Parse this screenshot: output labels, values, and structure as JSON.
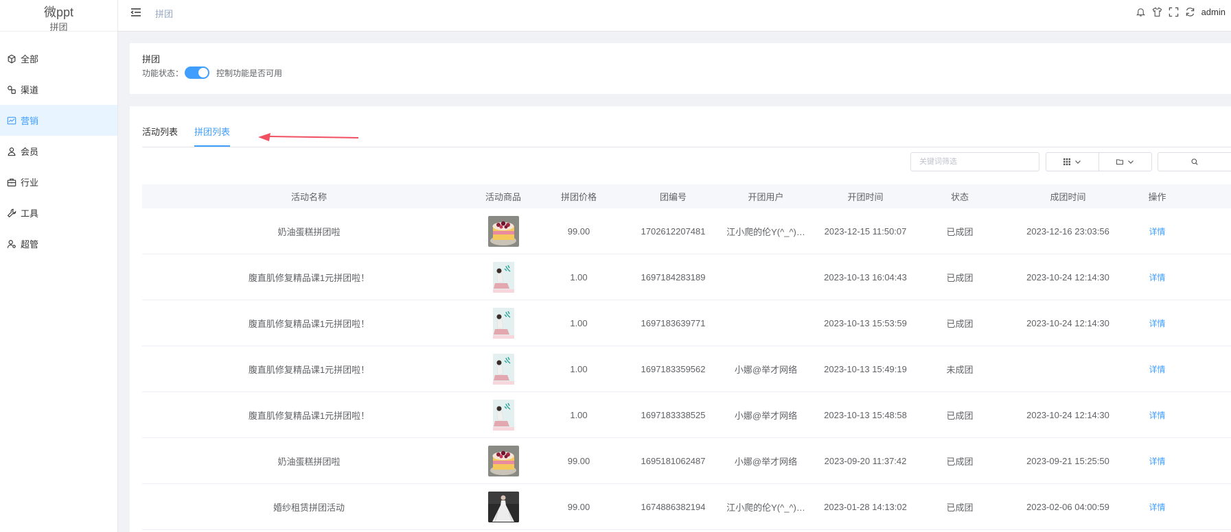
{
  "app": {
    "name": "微ppt",
    "sub": "拼团"
  },
  "sidebar": {
    "items": [
      {
        "label": "全部",
        "icon": "cube-icon"
      },
      {
        "label": "渠道",
        "icon": "channel-icon"
      },
      {
        "label": "营销",
        "icon": "chart-line-icon",
        "active": true
      },
      {
        "label": "会员",
        "icon": "user-icon"
      },
      {
        "label": "行业",
        "icon": "briefcase-icon"
      },
      {
        "label": "工具",
        "icon": "wrench-icon"
      },
      {
        "label": "超管",
        "icon": "admin-user-icon"
      }
    ]
  },
  "header": {
    "breadcrumb": "拼团",
    "user": "admin",
    "icons": [
      "bell-icon",
      "shirt-icon",
      "fullscreen-icon",
      "refresh-icon"
    ]
  },
  "feature_card": {
    "title": "拼团",
    "status_label": "功能状态：",
    "toggle_on": true,
    "status_desc": "控制功能是否可用"
  },
  "tabs": [
    {
      "label": "活动列表",
      "active": false
    },
    {
      "label": "拼团列表",
      "active": true
    }
  ],
  "toolbar": {
    "search_placeholder": "关键词筛选",
    "grid_icon": "grid-icon",
    "folder_icon": "folder-icon",
    "search_icon": "search-icon"
  },
  "table": {
    "columns": [
      "活动名称",
      "活动商品",
      "拼团价格",
      "团编号",
      "开团用户",
      "开团时间",
      "状态",
      "成团时间",
      "操作"
    ],
    "rows": [
      {
        "name": "奶油蛋糕拼团啦",
        "img": "cake",
        "price": "99.00",
        "group_no": "1702612207481",
        "user": "江小爬的伦Y(^_^)…",
        "open_time": "2023-12-15 11:50:07",
        "status": "已成团",
        "done_time": "2023-12-16 23:03:56",
        "action": "详情"
      },
      {
        "name": "腹直肌修复精品课1元拼团啦！",
        "img": "course",
        "price": "1.00",
        "group_no": "1697184283189",
        "user": "",
        "open_time": "2023-10-13 16:04:43",
        "status": "已成团",
        "done_time": "2023-10-24 12:14:30",
        "action": "详情"
      },
      {
        "name": "腹直肌修复精品课1元拼团啦！",
        "img": "course",
        "price": "1.00",
        "group_no": "1697183639771",
        "user": "",
        "open_time": "2023-10-13 15:53:59",
        "status": "已成团",
        "done_time": "2023-10-24 12:14:30",
        "action": "详情"
      },
      {
        "name": "腹直肌修复精品课1元拼团啦！",
        "img": "course",
        "price": "1.00",
        "group_no": "1697183359562",
        "user": "小娜@举才网络",
        "open_time": "2023-10-13 15:49:19",
        "status": "未成团",
        "done_time": "",
        "action": "详情"
      },
      {
        "name": "腹直肌修复精品课1元拼团啦！",
        "img": "course",
        "price": "1.00",
        "group_no": "1697183338525",
        "user": "小娜@举才网络",
        "open_time": "2023-10-13 15:48:58",
        "status": "已成团",
        "done_time": "2023-10-24 12:14:30",
        "action": "详情"
      },
      {
        "name": "奶油蛋糕拼团啦",
        "img": "cake",
        "price": "99.00",
        "group_no": "1695181062487",
        "user": "小娜@举才网络",
        "open_time": "2023-09-20 11:37:42",
        "status": "已成团",
        "done_time": "2023-09-21 15:25:50",
        "action": "详情"
      },
      {
        "name": "婚纱租赁拼团活动",
        "img": "dress",
        "price": "99.00",
        "group_no": "1674886382194",
        "user": "江小爬的伦Y(^_^)…",
        "open_time": "2023-01-28 14:13:02",
        "status": "已成团",
        "done_time": "2023-02-06 04:00:59",
        "action": "详情"
      }
    ]
  },
  "colors": {
    "accent": "#409eff",
    "arrow": "#f05060",
    "active_menu_bg": "#e8f4ff"
  }
}
